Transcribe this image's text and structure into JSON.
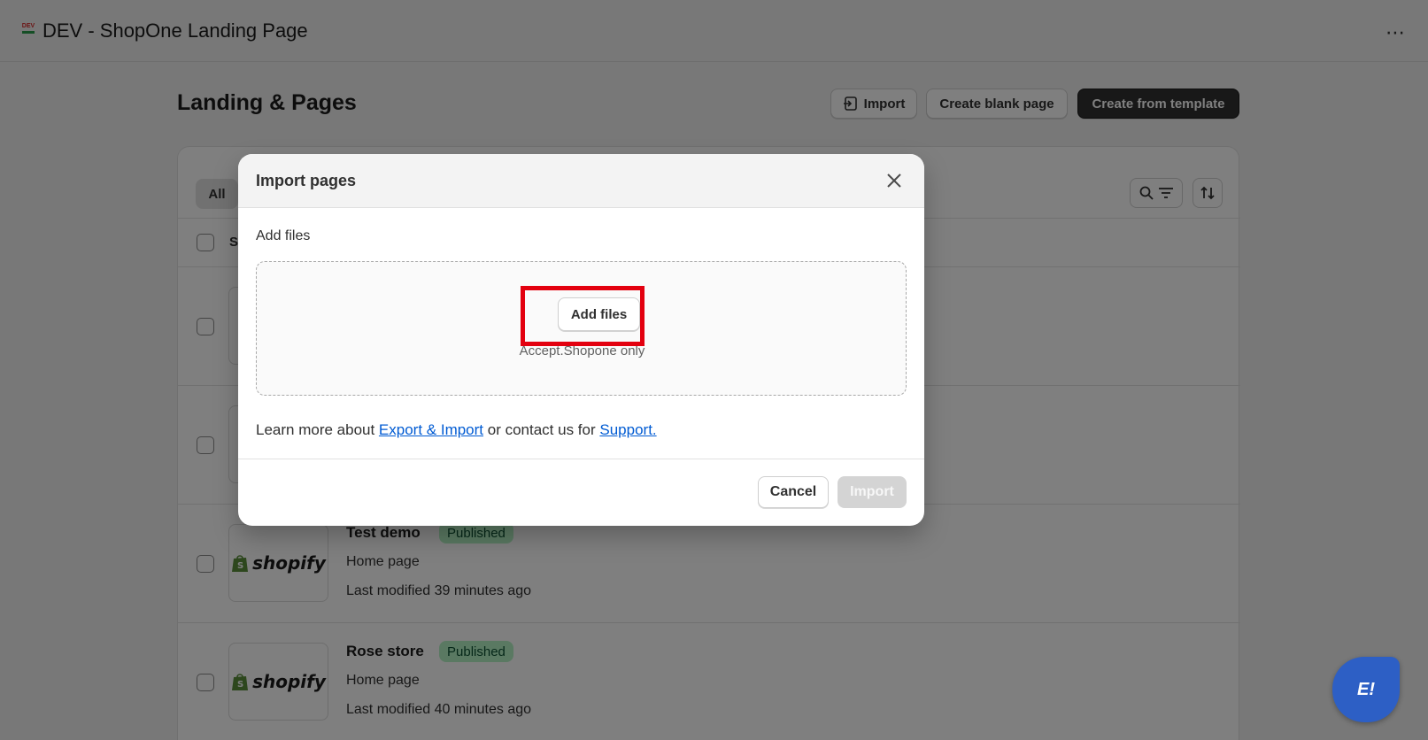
{
  "app": {
    "logo_text": "DEV",
    "title": "DEV - ShopOne Landing Page",
    "more_icon": "ellipsis-icon"
  },
  "page": {
    "heading": "Landing & Pages",
    "import_label": "Import",
    "blank_label": "Create blank page",
    "template_label": "Create from template"
  },
  "list": {
    "tab_all": "All",
    "header_partial": "S",
    "rows": [
      {
        "title": "Test demo",
        "status": "Published",
        "type": "Home page",
        "modified": "Last modified 39 minutes ago",
        "thumb": "shopify"
      },
      {
        "title": "Rose store",
        "status": "Published",
        "type": "Home page",
        "modified": "Last modified 40 minutes ago",
        "thumb": "shopify"
      }
    ]
  },
  "modal": {
    "title": "Import pages",
    "section_label": "Add files",
    "add_files_button": "Add files",
    "accept_note": "Accept.Shopone only",
    "learn_prefix": "Learn more about ",
    "learn_link": "Export & Import",
    "learn_middle": " or contact us for ",
    "support_link": "Support.",
    "cancel_label": "Cancel",
    "import_label": "Import"
  },
  "colors": {
    "highlight": "#e3000f",
    "badge_bg": "#b4f3c5",
    "link": "#005bd3",
    "chat": "#2d5fc5"
  }
}
